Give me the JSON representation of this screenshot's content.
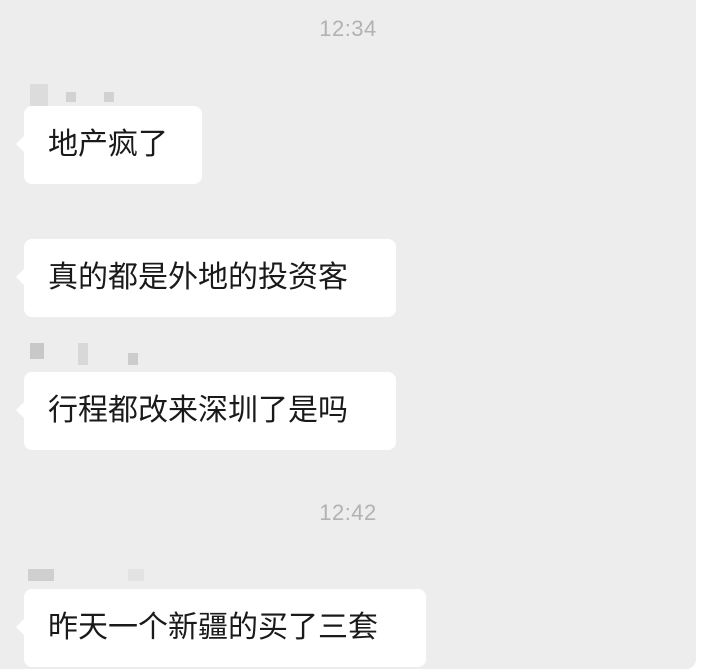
{
  "chat": {
    "timestamps": [
      "12:34",
      "12:42"
    ],
    "messages": [
      {
        "text": "地产疯了"
      },
      {
        "text": "真的都是外地的投资客"
      },
      {
        "text": "行程都改来深圳了是吗"
      },
      {
        "text": "昨天一个新疆的买了三套"
      }
    ]
  },
  "colors": {
    "background": "#ededed",
    "bubble": "#ffffff",
    "text": "#1a1a1a",
    "timestamp": "#b2b2b2"
  }
}
